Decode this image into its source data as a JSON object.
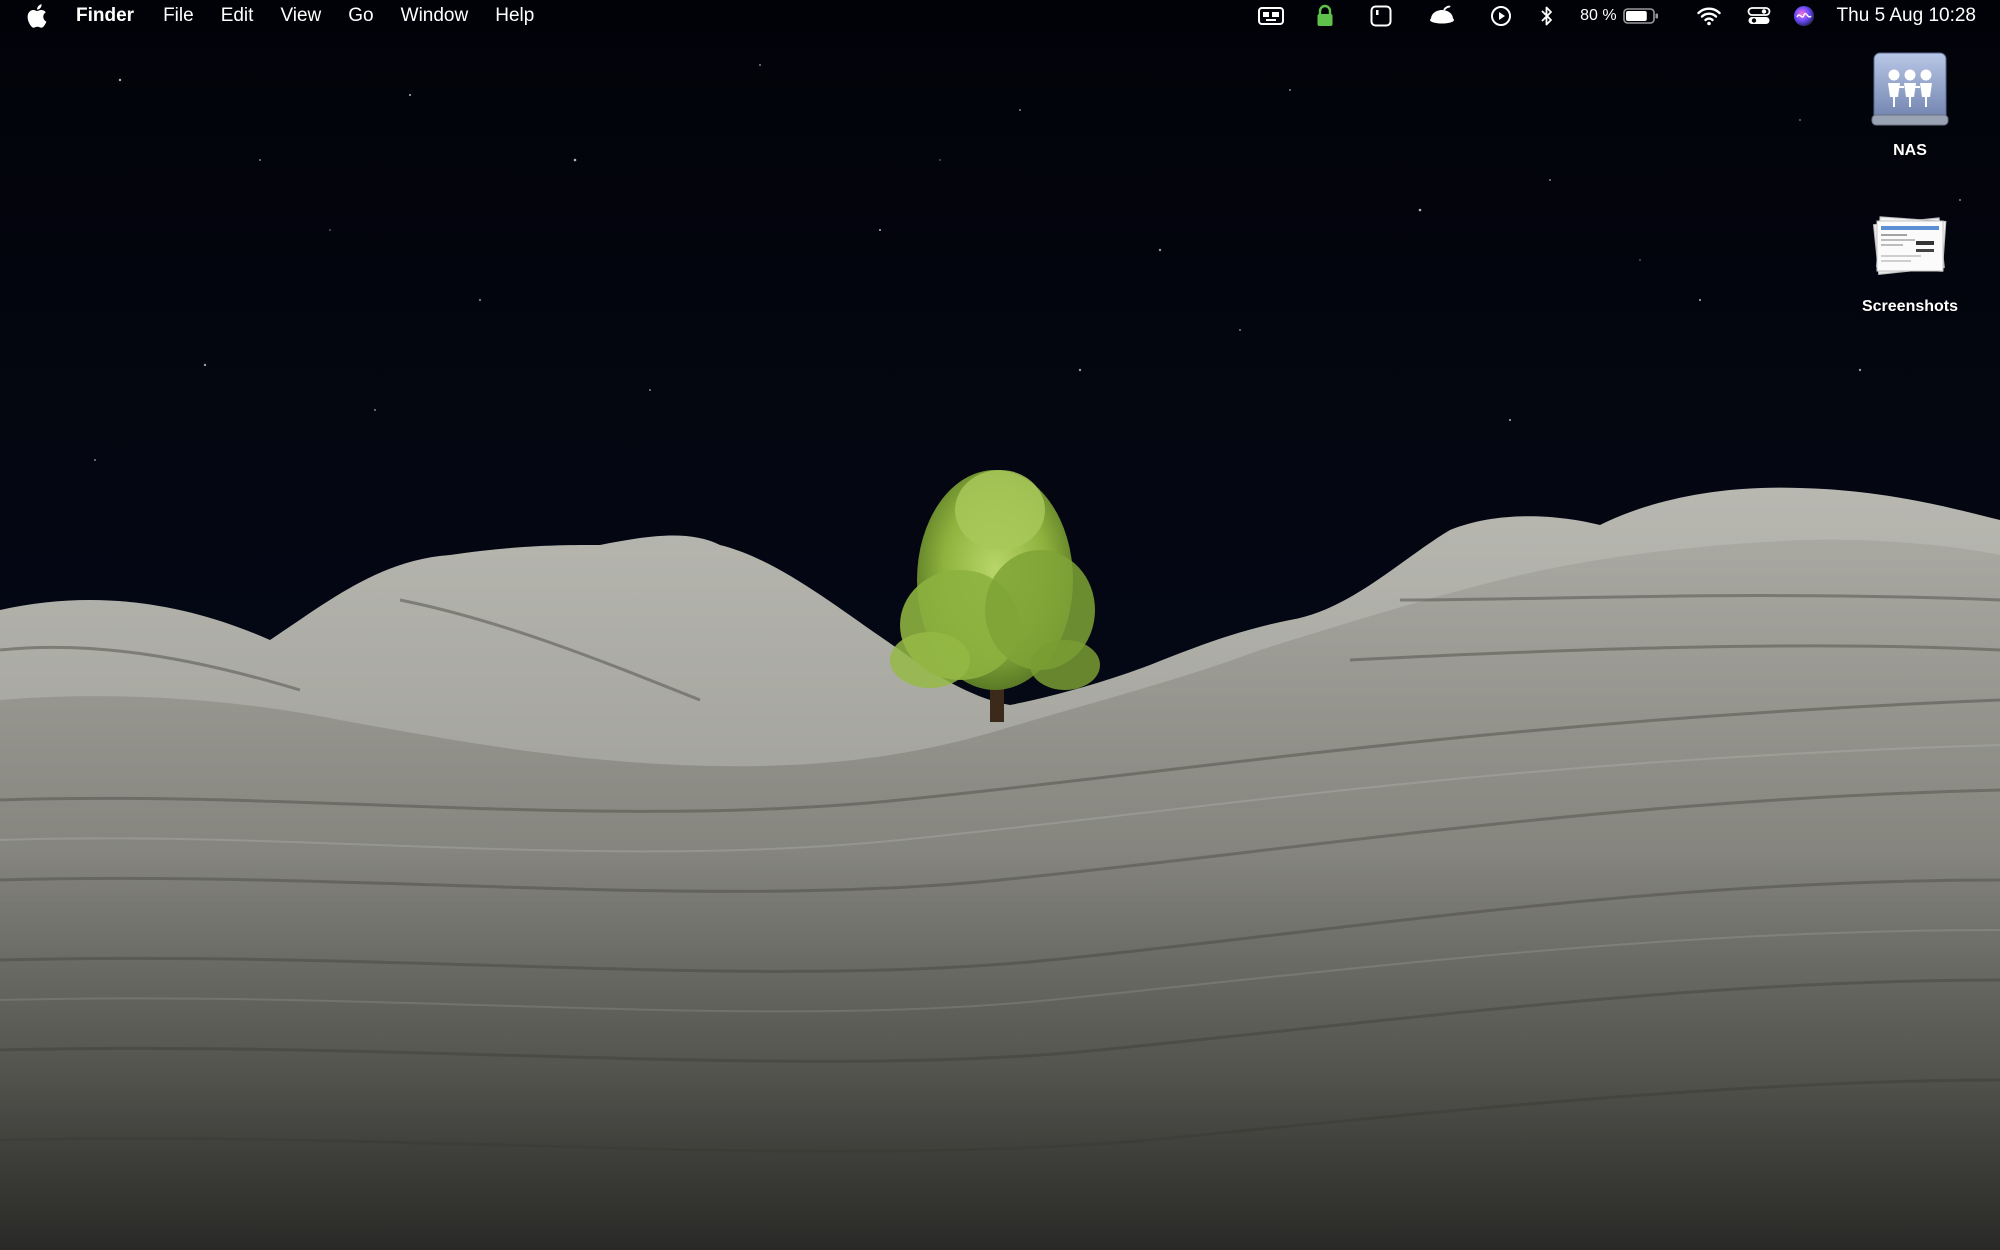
{
  "menubar": {
    "app_name": "Finder",
    "menus": [
      "File",
      "Edit",
      "View",
      "Go",
      "Window",
      "Help"
    ],
    "status_icons": [
      "screen-record-icon",
      "lock-icon",
      "app-window-icon",
      "cloud-cap-icon",
      "play-circle-icon",
      "bluetooth-icon"
    ],
    "battery_percent": "80 %",
    "battery_level": 0.8,
    "clock": "Thu 5 Aug  10:28"
  },
  "desktop_icons": [
    {
      "label": "NAS",
      "icon": "network-drive-icon"
    },
    {
      "label": "Screenshots",
      "icon": "screenshots-stack-icon"
    }
  ],
  "colors": {
    "sky": "#03040a",
    "rock": "#8f8f88",
    "tree": "#9cbf48",
    "menubar_text": "#ffffff"
  }
}
